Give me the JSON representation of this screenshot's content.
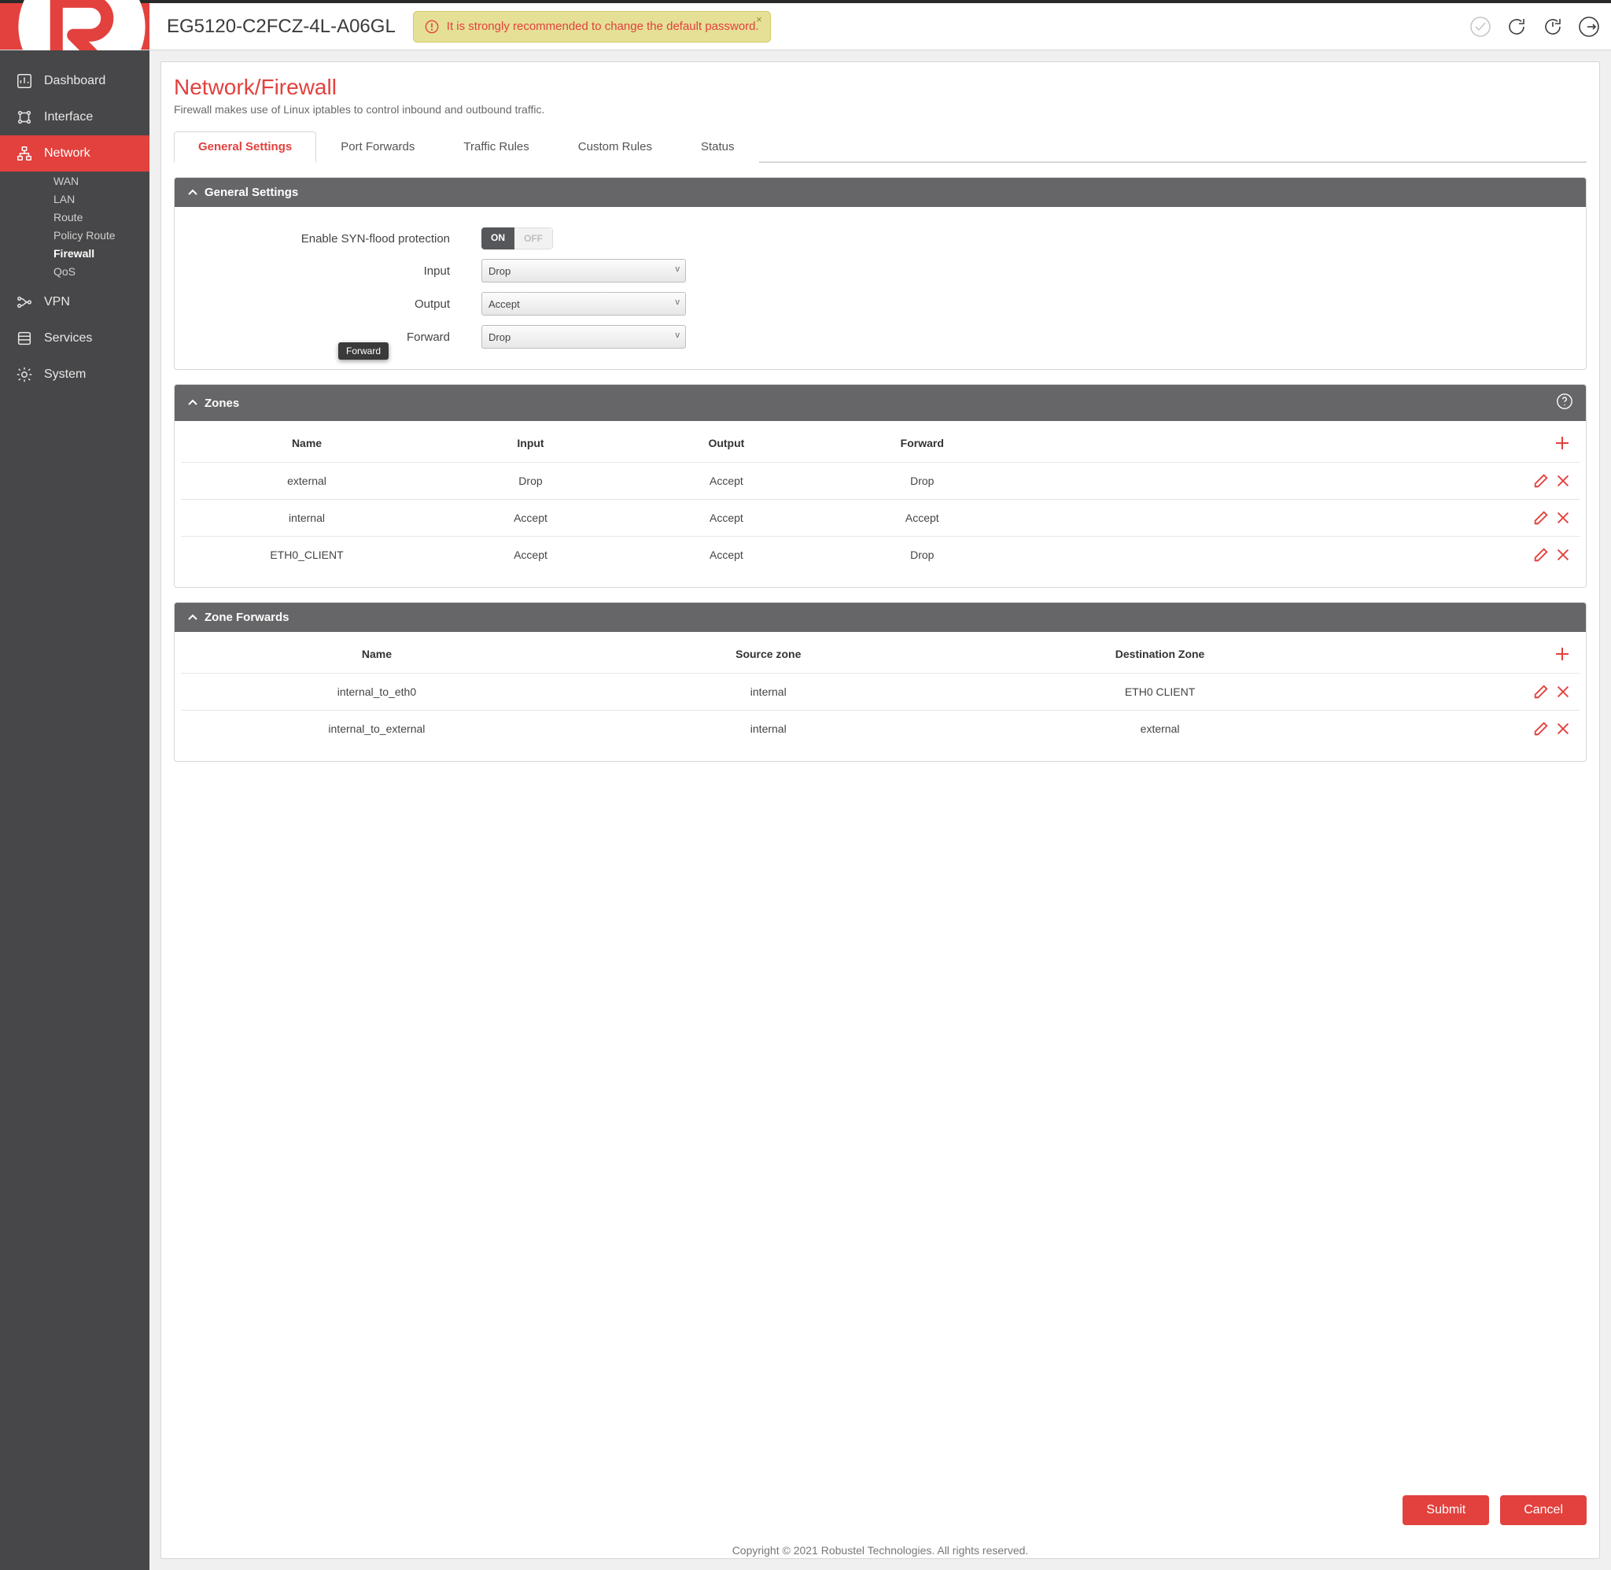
{
  "brand": "robustel",
  "device_id": "EG5120-C2FCZ-4L-A06GL",
  "alert_text": "It is strongly recommended to change the default password.",
  "sidebar": {
    "items": [
      {
        "label": "Dashboard"
      },
      {
        "label": "Interface"
      },
      {
        "label": "Network"
      },
      {
        "label": "VPN"
      },
      {
        "label": "Services"
      },
      {
        "label": "System"
      }
    ],
    "sub_network": [
      {
        "label": "WAN"
      },
      {
        "label": "LAN"
      },
      {
        "label": "Route"
      },
      {
        "label": "Policy Route"
      },
      {
        "label": "Firewall"
      },
      {
        "label": "QoS"
      }
    ]
  },
  "page": {
    "title": "Network/Firewall",
    "description": "Firewall makes use of Linux iptables to control inbound and outbound traffic."
  },
  "tabs": [
    "General Settings",
    "Port Forwards",
    "Traffic Rules",
    "Custom Rules",
    "Status"
  ],
  "general": {
    "panel_title": "General Settings",
    "syn_label": "Enable SYN-flood protection",
    "syn_on": "ON",
    "syn_off": "OFF",
    "input_label": "Input",
    "input_value": "Drop",
    "output_label": "Output",
    "output_value": "Accept",
    "forward_label": "Forward",
    "forward_value": "Drop",
    "tooltip": "Forward"
  },
  "zones": {
    "panel_title": "Zones",
    "headers": {
      "name": "Name",
      "input": "Input",
      "output": "Output",
      "forward": "Forward"
    },
    "rows": [
      {
        "name": "external",
        "input": "Drop",
        "output": "Accept",
        "forward": "Drop"
      },
      {
        "name": "internal",
        "input": "Accept",
        "output": "Accept",
        "forward": "Accept"
      },
      {
        "name": "ETH0_CLIENT",
        "input": "Accept",
        "output": "Accept",
        "forward": "Drop"
      }
    ]
  },
  "zone_forwards": {
    "panel_title": "Zone Forwards",
    "headers": {
      "name": "Name",
      "src": "Source zone",
      "dst": "Destination Zone"
    },
    "rows": [
      {
        "name": "internal_to_eth0",
        "src": "internal",
        "dst": "ETH0 CLIENT"
      },
      {
        "name": "internal_to_external",
        "src": "internal",
        "dst": "external"
      }
    ]
  },
  "buttons": {
    "submit": "Submit",
    "cancel": "Cancel"
  },
  "footer": "Copyright © 2021 Robustel Technologies. All rights reserved."
}
